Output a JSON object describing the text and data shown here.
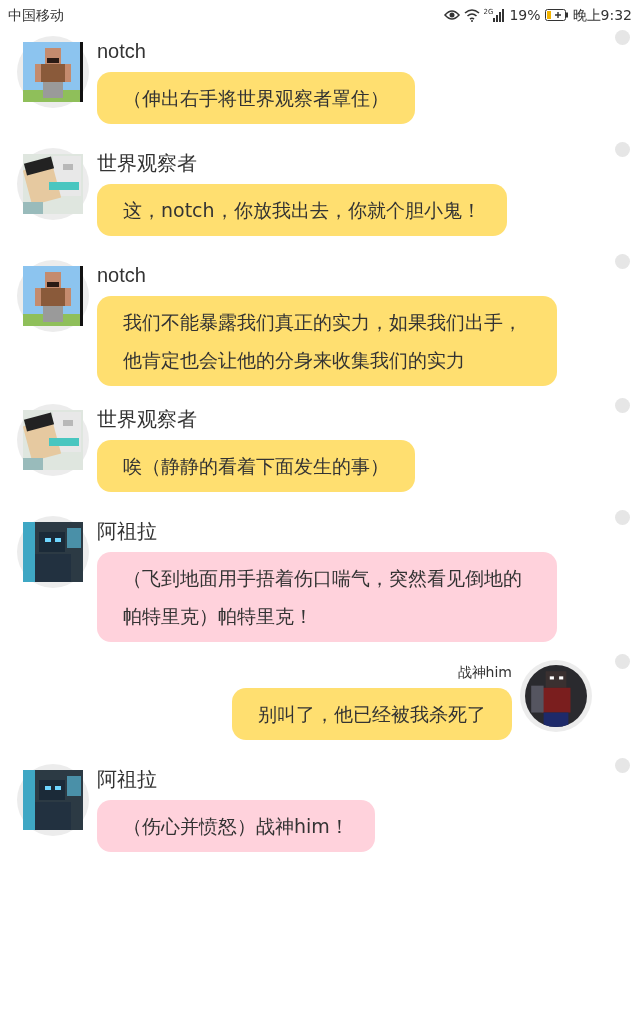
{
  "status_bar": {
    "carrier": "中国移动",
    "network": "2G",
    "battery": "19%",
    "time": "晚上9:32"
  },
  "messages": [
    {
      "kind": "received",
      "sender": "notch",
      "text": "（伸出右手将世界观察者罩住）",
      "color": "#ffdf70"
    },
    {
      "kind": "received",
      "sender": "世界观察者",
      "text": "这，notch，你放我出去，你就个胆小鬼！",
      "color": "#ffdf70"
    },
    {
      "kind": "received",
      "sender": "notch",
      "text": "我们不能暴露我们真正的实力，如果我们出手，他肯定也会让他的分身来收集我们的实力",
      "color": "#ffdf70"
    },
    {
      "kind": "received",
      "sender": "世界观察者",
      "text": "唉（静静的看着下面发生的事）",
      "color": "#ffdf70"
    },
    {
      "kind": "received",
      "sender": "阿祖拉",
      "text": "（飞到地面用手捂着伤口喘气，突然看见倒地的帕特里克）帕特里克！",
      "color": "#ffd2dc"
    },
    {
      "kind": "sent",
      "sender": "战神him",
      "text": "别叫了，他已经被我杀死了",
      "color": "#ffdf70"
    },
    {
      "kind": "received",
      "sender": "阿祖拉",
      "text": "（伤心并愤怒）战神him！",
      "color": "#ffd2dc"
    }
  ]
}
